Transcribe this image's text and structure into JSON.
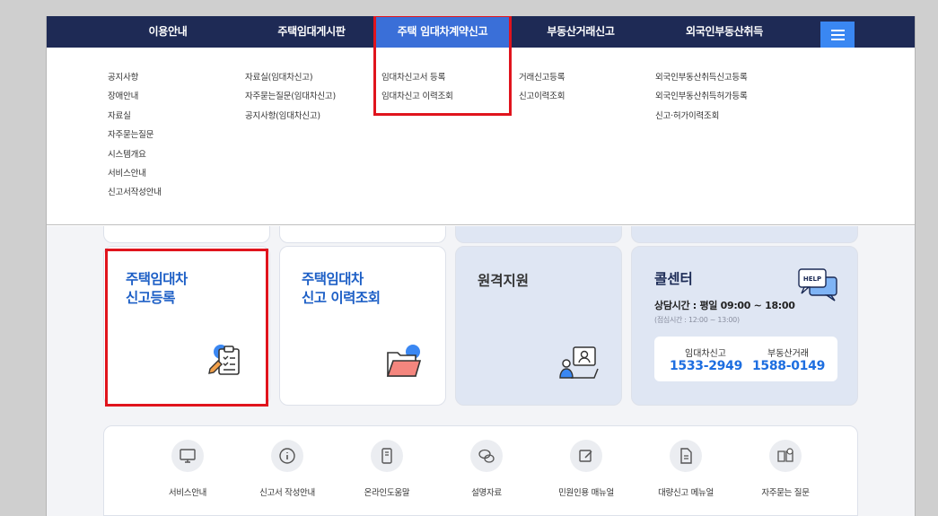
{
  "nav": {
    "items": [
      "이용안내",
      "주택임대게시판",
      "주택 임대차계약신고",
      "부동산거래신고",
      "외국인부동산취득"
    ],
    "active_index": 2
  },
  "dropdown": {
    "col0": [
      "공지사항",
      "장애안내",
      "자료실",
      "자주묻는질문",
      "시스템개요",
      "서비스안내",
      "신고서작성안내"
    ],
    "col1": [
      "자료실(임대차신고)",
      "자주묻는질문(임대차신고)",
      "공지사항(임대차신고)"
    ],
    "col2": [
      "임대차신고서 등록",
      "임대차신고 이력조회"
    ],
    "col3": [
      "거래신고등록",
      "신고이력조회"
    ],
    "col4": [
      "외국인부동산취득신고등록",
      "외국인부동산취득허가등록",
      "신고·허가이력조회"
    ]
  },
  "cards": {
    "register": {
      "line1": "주택임대차",
      "line2": "신고등록"
    },
    "history": {
      "line1": "주택임대차",
      "line2": "신고 이력조회"
    },
    "remote": {
      "title": "원격지원"
    },
    "callcenter": {
      "title": "콜센터",
      "help_badge": "HELP",
      "hours": "상담시간 : 평일 09:00 ~ 18:00",
      "break": "(점심시간 : 12:00 ~ 13:00)",
      "lines": [
        {
          "label": "임대차신고",
          "number": "1533-2949"
        },
        {
          "label": "부동산거래",
          "number": "1588-0149"
        }
      ]
    }
  },
  "quick_links": [
    "서비스안내",
    "신고서 작성안내",
    "온라인도움말",
    "설명자료",
    "민원인용 매뉴얼",
    "대량신고 메뉴얼",
    "자주묻는 질문"
  ],
  "colors": {
    "nav_bg": "#1e2a55",
    "accent": "#3a6fd8",
    "highlight": "#e0141d",
    "link_blue": "#1d5fc6"
  }
}
